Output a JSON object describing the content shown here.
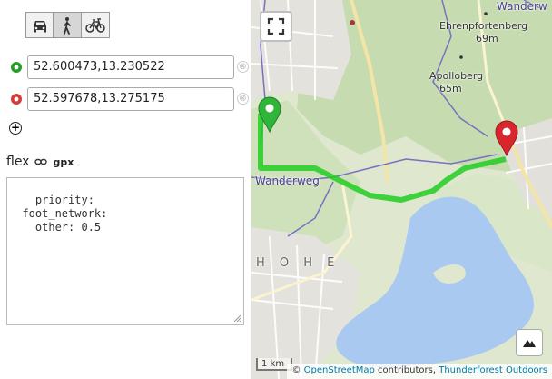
{
  "modes": [
    {
      "name": "car",
      "active": false
    },
    {
      "name": "foot",
      "active": true
    },
    {
      "name": "bike",
      "active": false
    }
  ],
  "points": {
    "start": {
      "value": "52.600473,13.230522",
      "color": "#2a9d2a"
    },
    "end": {
      "value": "52.597678,13.275175",
      "color": "#d63c3c"
    },
    "clear_glyph": "⊗",
    "add_glyph": "+"
  },
  "profile": {
    "flex_label": "flex",
    "gpx_label": "gpx",
    "custom_model": "priority:\n  foot_network:\n    other: 0.5"
  },
  "map": {
    "place_labels": [
      {
        "text": "Ehrenpfortenberg"
      },
      {
        "text": "69m"
      },
      {
        "text": "Apolloberg"
      },
      {
        "text": "65m"
      },
      {
        "text": "Wanderweg"
      },
      {
        "text": "Wanderw"
      },
      {
        "text": "H O H E"
      }
    ],
    "scale_label": "1 km",
    "attribution": {
      "copyright": "©",
      "osm": "OpenStreetMap",
      "contributors": "contributors,",
      "tiles": "Thunderforest Outdoors"
    },
    "route_color": "#22cc22",
    "water_color": "#a9c9f0"
  }
}
